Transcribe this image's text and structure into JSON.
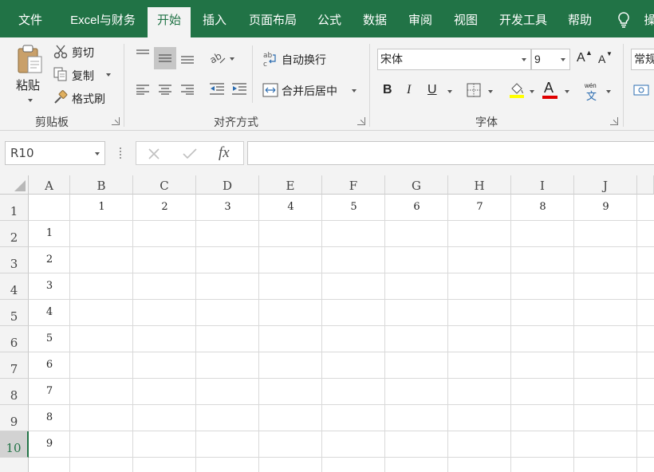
{
  "tabs": [
    "文件",
    "Excel与财务",
    "开始",
    "插入",
    "页面布局",
    "公式",
    "数据",
    "审阅",
    "视图",
    "开发工具",
    "帮助",
    "操"
  ],
  "ribbon": {
    "clipboard": {
      "paste": "粘贴",
      "cut": "剪切",
      "copy": "复制",
      "format_painter": "格式刷",
      "label": "剪贴板"
    },
    "alignment": {
      "wrap_text": "自动换行",
      "merge_center": "合并后居中",
      "label": "对齐方式"
    },
    "font": {
      "font_name": "宋体",
      "font_size": "9",
      "bold": "B",
      "italic": "I",
      "underline": "U",
      "font_color_letter": "A",
      "phonetic_top": "wén",
      "phonetic_bottom": "文",
      "grow_letter": "A",
      "shrink_letter": "A",
      "label": "字体"
    },
    "number": {
      "format": "常规"
    }
  },
  "formula_bar": {
    "name_box": "R10",
    "fx_label": "fx",
    "formula": ""
  },
  "grid": {
    "columns": [
      "A",
      "B",
      "C",
      "D",
      "E",
      "F",
      "G",
      "H",
      "I",
      "J"
    ],
    "rows": [
      "1",
      "2",
      "3",
      "4",
      "5",
      "6",
      "7",
      "8",
      "9",
      "10"
    ],
    "selected_row": "10",
    "row1_values": [
      "1",
      "2",
      "3",
      "4",
      "5",
      "6",
      "7",
      "8",
      "9"
    ],
    "colA_values": [
      "1",
      "2",
      "3",
      "4",
      "5",
      "6",
      "7",
      "8",
      "9"
    ]
  },
  "colors": {
    "brand_green": "#217346",
    "font_color_bar": "#e00000"
  }
}
